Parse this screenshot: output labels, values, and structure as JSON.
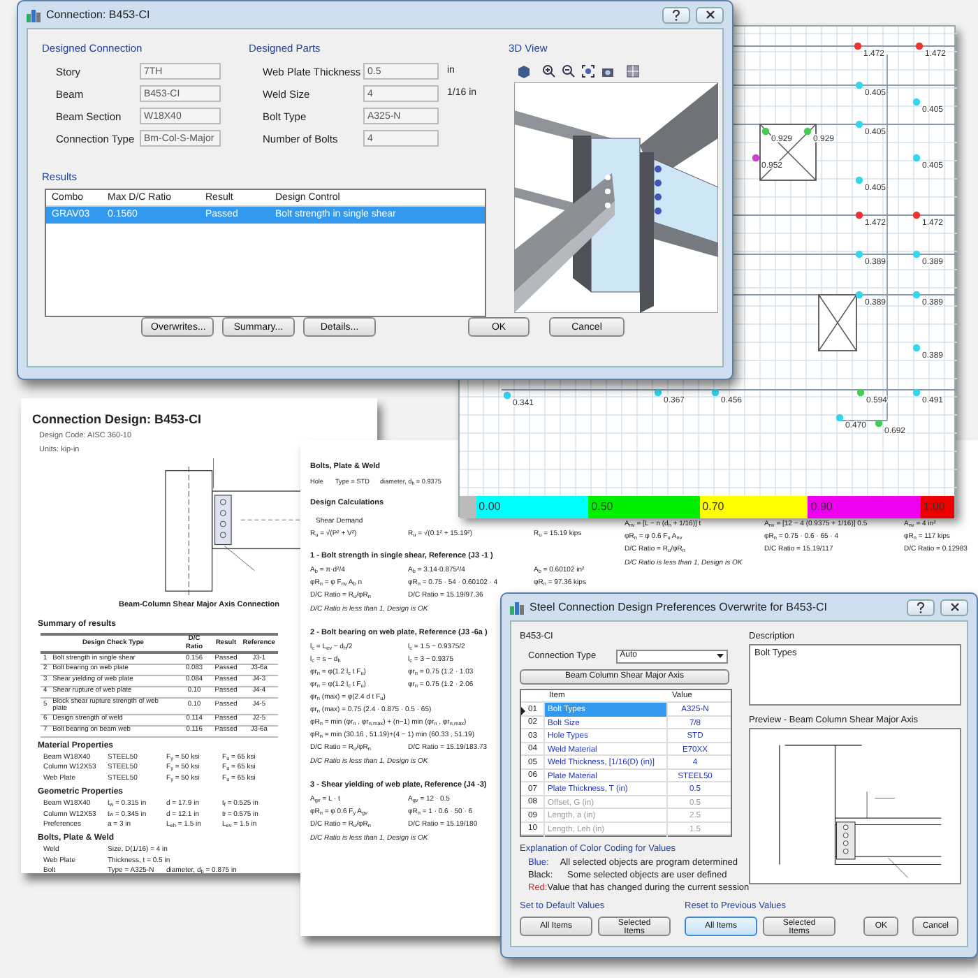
{
  "connection_dialog": {
    "title": "Connection: B453-CI",
    "designed_connection": {
      "heading": "Designed Connection",
      "fields": [
        {
          "label": "Story",
          "value": "7TH"
        },
        {
          "label": "Beam",
          "value": "B453-CI"
        },
        {
          "label": "Beam Section",
          "value": "W18X40"
        },
        {
          "label": "Connection Type",
          "value": "Bm-Col-S-Major"
        }
      ]
    },
    "designed_parts": {
      "heading": "Designed Parts",
      "fields": [
        {
          "label": "Web Plate Thickness",
          "value": "0.5",
          "unit": "in"
        },
        {
          "label": "Weld Size",
          "value": "4",
          "unit": "1/16 in"
        },
        {
          "label": "Bolt Type",
          "value": "A325-N"
        },
        {
          "label": "Number of Bolts",
          "value": "4"
        }
      ]
    },
    "view_3d": {
      "heading": "3D View"
    },
    "results": {
      "heading": "Results",
      "columns": [
        "Combo",
        "Max D/C Ratio",
        "Result",
        "Design Control"
      ],
      "rows": [
        {
          "cells": [
            "GRAV03",
            "0.1560",
            "Passed",
            "Bolt strength in single shear"
          ],
          "selected": true
        }
      ]
    },
    "buttons": [
      "Overwrites...",
      "Summary...",
      "Details..."
    ],
    "ok": "OK",
    "cancel": "Cancel"
  },
  "model_view": {
    "points": [
      {
        "label": "1.472",
        "color": "#ee3333"
      },
      {
        "label": "1.472",
        "color": "#ee3333"
      },
      {
        "label": "0.405",
        "color": "#33d6ee"
      },
      {
        "label": "0.405",
        "color": "#33d6ee"
      },
      {
        "label": "0.929",
        "color": "#44cc55"
      },
      {
        "label": "0.929",
        "color": "#44cc55"
      },
      {
        "label": "0.405",
        "color": "#33d6ee"
      },
      {
        "label": "0.952",
        "color": "#cc44cc"
      },
      {
        "label": "0.405",
        "color": "#33d6ee"
      },
      {
        "label": "0.405",
        "color": "#33d6ee"
      },
      {
        "label": "1.472",
        "color": "#ee3333"
      },
      {
        "label": "1.472",
        "color": "#ee3333"
      },
      {
        "label": "0.389",
        "color": "#33d6ee"
      },
      {
        "label": "0.389",
        "color": "#33d6ee"
      },
      {
        "label": "0.389",
        "color": "#33d6ee"
      },
      {
        "label": "0.389",
        "color": "#33d6ee"
      },
      {
        "label": "0.389",
        "color": "#33d6ee"
      },
      {
        "label": "0.341",
        "color": "#33d6ee"
      },
      {
        "label": "0.367",
        "color": "#33d6ee"
      },
      {
        "label": "0.456",
        "color": "#33d6ee"
      },
      {
        "label": "0.594",
        "color": "#44cc55"
      },
      {
        "label": "0.491",
        "color": "#33d6ee"
      },
      {
        "label": "0.470",
        "color": "#33d6ee"
      },
      {
        "label": "0.692",
        "color": "#44cc55"
      }
    ],
    "legend": [
      {
        "label": "0.00",
        "color": "#00ffff"
      },
      {
        "label": "0.50",
        "color": "#00ee00"
      },
      {
        "label": "0.70",
        "color": "#ffff00"
      },
      {
        "label": "0.90",
        "color": "#ee00ee"
      },
      {
        "label": "1.00",
        "color": "#ee0000"
      }
    ]
  },
  "summary_report": {
    "title": "Connection Design: B453-CI",
    "design_code": "Design Code: AISC 360-10",
    "units": "Units: kip-in",
    "caption": "Beam-Column Shear Major Axis Connection",
    "summary": {
      "heading": "Summary of results",
      "columns": [
        "",
        "Design Check Type",
        "D/C Ratio",
        "Result",
        "Reference"
      ],
      "rows": [
        [
          "1",
          "Bolt strength in single shear",
          "0.156",
          "Passed",
          "J3-1"
        ],
        [
          "2",
          "Bolt bearing on web plate",
          "0.083",
          "Passed",
          "J3-6a"
        ],
        [
          "3",
          "Shear yielding of web plate",
          "0.084",
          "Passed",
          "J4-3"
        ],
        [
          "4",
          "Shear rupture of web plate",
          "0.10",
          "Passed",
          "J4-4"
        ],
        [
          "5",
          "Block shear rupture strength of web plate",
          "0.10",
          "Passed",
          "J4-5"
        ],
        [
          "6",
          "Design strength of weld",
          "0.114",
          "Passed",
          "J2-5"
        ],
        [
          "7",
          "Bolt bearing on beam web",
          "0.116",
          "Passed",
          "J3-6a"
        ]
      ]
    },
    "sections": [
      {
        "heading": "Material Properties",
        "rows": [
          [
            "Beam W18X40",
            "STEEL50",
            "F$_{y}$ = 50 ksi",
            "F$_{u}$ = 65 ksi"
          ],
          [
            "Column W12X53",
            "STEEL50",
            "F$_{y}$ = 50 ksi",
            "F$_{u}$ = 65 ksi"
          ],
          [
            "Web Plate",
            "STEEL50",
            "F$_{y}$ = 50 ksi",
            "F$_{u}$ = 65 ksi"
          ]
        ]
      },
      {
        "heading": "Geometric Properties",
        "rows": [
          [
            "Beam W18X40",
            "t$_{w}$ = 0.315 in",
            "d = 17.9 in",
            "t$_{f}$ = 0.525 in"
          ],
          [
            "Column W12X53",
            "t$_{w}$ = 0.345 in",
            "d = 12.1 in",
            "t$_{f}$ = 0.575 in"
          ],
          [
            "Preferences",
            "a = 3 in",
            "L$_{eh}$ = 1.5 in",
            "L$_{ev}$ = 1.5 in"
          ]
        ]
      },
      {
        "heading": "Bolts, Plate & Weld",
        "rows": [
          [
            "Weld",
            "Size, D(1/16) = 4 in"
          ],
          [
            "Web Plate",
            "Thickness, t = 0.5 in"
          ],
          [
            "Bolt",
            "Type = A325-N",
            "diameter, d$_{b}$ = 0.875 in"
          ]
        ]
      }
    ]
  },
  "calculation_report": {
    "left": [
      {
        "kind": "heading",
        "cells": [
          "Bolts, Plate & Weld"
        ]
      },
      {
        "kind": "spec",
        "cells": [
          "Hole",
          "Type = STD",
          "diameter, d$_{h}$ = 0.9375"
        ]
      },
      {
        "kind": "heading",
        "cells": [
          "Design Calculations"
        ]
      },
      {
        "kind": "label",
        "cells": [
          "Shear Demand"
        ]
      },
      {
        "kind": "formula",
        "cells": [
          "R$_{u}$ = √(P² + V²)",
          "R$_{u}$ = √(0.1² + 15.19²)",
          "R$_{u}$ = 15.19 kips"
        ]
      },
      {
        "kind": "heading",
        "cells": [
          "1 - Bolt strength in single shear, Reference (J3 -1 )"
        ]
      },
      {
        "kind": "formula",
        "cells": [
          "A$_{b}$ = π·d²/4",
          "A$_{b}$ = 3.14·0.875²/4",
          "A$_{b}$ = 0.60102 in²"
        ]
      },
      {
        "kind": "formula",
        "cells": [
          "φR$_{n}$ = φ F$_{nv}$ A$_{b}$ n",
          "φR$_{n}$ = 0.75 · 54 · 0.60102 · 4",
          "φR$_{n}$ = 97.36 kips"
        ]
      },
      {
        "kind": "formula",
        "cells": [
          "D/C Ratio = R$_{u}$/φR$_{n}$",
          "D/C Ratio = 15.19/97.36"
        ]
      },
      {
        "kind": "note",
        "cells": [
          "D/C Ratio is less than 1, Design is OK"
        ]
      },
      {
        "kind": "heading",
        "cells": [
          "2 - Bolt bearing on web plate, Reference (J3 -6a )"
        ]
      },
      {
        "kind": "formula",
        "cells": [
          "l$_{c}$ = L$_{ev}$ − d$_{h}$/2",
          "l$_{c}$ = 1.5 − 0.9375/2"
        ]
      },
      {
        "kind": "formula",
        "cells": [
          "l$_{c}$ = s − d$_{h}$",
          "l$_{c}$ = 3 − 0.9375"
        ]
      },
      {
        "kind": "formula",
        "cells": [
          "φr$_{n}$ = φ(1.2 l$_{c}$ t F$_{u}$)",
          "φr$_{n}$ = 0.75 (1.2 · 1.03"
        ]
      },
      {
        "kind": "formula",
        "cells": [
          "φr$_{n}$ = φ(1.2 l$_{c}$ t F$_{u}$)",
          "φr$_{n}$ = 0.75 (1.2 · 2.06"
        ]
      },
      {
        "kind": "wide",
        "cells": [
          "φr$_{n}$ (max) = φ(2.4 d t F$_{u}$)"
        ]
      },
      {
        "kind": "wide",
        "cells": [
          "φr$_{n}$ (max) = 0.75 (2.4 · 0.875 · 0.5 · 65)"
        ]
      },
      {
        "kind": "wide",
        "cells": [
          "φR$_{n}$ = min (φr$_{n}$ , φr$_{n,max}$) + (n−1) min (φr$_{n}$ , φr$_{n,max}$)"
        ]
      },
      {
        "kind": "wide",
        "cells": [
          "φR$_{n}$ = min (30.16 , 51.19)+(4 − 1) min (60.33 , 51.19)"
        ]
      },
      {
        "kind": "formula",
        "cells": [
          "D/C Ratio = R$_{u}$/φR$_{n}$",
          "D/C Ratio = 15.19/183.73"
        ]
      },
      {
        "kind": "note",
        "cells": [
          "D/C Ratio is less than 1, Design is OK"
        ]
      },
      {
        "kind": "heading",
        "cells": [
          "3 - Shear yielding of web plate, Reference (J4 -3)"
        ]
      },
      {
        "kind": "formula",
        "cells": [
          "A$_{gv}$ = L · t",
          "A$_{gv}$ = 12 · 0.5"
        ]
      },
      {
        "kind": "formula",
        "cells": [
          "φR$_{n}$ = φ 0.6 F$_{y}$ A$_{gv}$",
          "φR$_{n}$ = 1 · 0.6 · 50 · 6"
        ]
      },
      {
        "kind": "formula",
        "cells": [
          "D/C Ratio = R$_{u}$/φR$_{n}$",
          "D/C Ratio = 15.19/180"
        ]
      },
      {
        "kind": "note",
        "cells": [
          "D/C Ratio is less than 1, Design is OK"
        ]
      }
    ],
    "right": [
      {
        "kind": "formula",
        "cells": [
          "A$_{nv}$ = [L − n (d$_{h}$ + 1/16)] t",
          "A$_{nv}$ = [12 − 4 (0.9375 + 1/16)] 0.5",
          "A$_{nv}$ = 4 in²"
        ]
      },
      {
        "kind": "formula",
        "cells": [
          "φR$_{n}$ = φ 0.6 F$_{u}$ A$_{nv}$",
          "φR$_{n}$ = 0.75 · 0.6 · 65 · 4",
          "φR$_{n}$ = 117 kips"
        ]
      },
      {
        "kind": "formula",
        "cells": [
          "D/C Ratio = R$_{u}$/φR$_{n}$",
          "D/C Ratio = 15.19/117",
          "D/C Ratio = 0.12983"
        ]
      },
      {
        "kind": "note",
        "cells": [
          "D/C Ratio is less than 1, Design is OK"
        ]
      }
    ]
  },
  "overwrite_dialog": {
    "title": "Steel Connection Design Preferences Overwrite for B453-CI",
    "beam": "B453-CI",
    "connection_type": {
      "label": "Connection Type",
      "value": "Auto"
    },
    "type_button": "Beam Column Shear Major Axis",
    "grid": {
      "columns": [
        "Item",
        "Value"
      ],
      "rows": [
        {
          "number": "01",
          "item": "Bolt Types",
          "value": "A325-N",
          "selected": true,
          "disabled": false
        },
        {
          "number": "02",
          "item": "Bolt Size",
          "value": "7/8",
          "selected": false,
          "disabled": false
        },
        {
          "number": "03",
          "item": "Hole Types",
          "value": "STD",
          "selected": false,
          "disabled": false
        },
        {
          "number": "04",
          "item": "Weld Material",
          "value": "E70XX",
          "selected": false,
          "disabled": false
        },
        {
          "number": "05",
          "item": "Weld Thickness, [1/16(D) (in)]",
          "value": "4",
          "selected": false,
          "disabled": false
        },
        {
          "number": "06",
          "item": "Plate Material",
          "value": "STEEL50",
          "selected": false,
          "disabled": false
        },
        {
          "number": "07",
          "item": "Plate Thickness, T (in)",
          "value": "0.5",
          "selected": false,
          "disabled": false
        },
        {
          "number": "08",
          "item": "Offset, G (in)",
          "value": "0.5",
          "selected": false,
          "disabled": true
        },
        {
          "number": "09",
          "item": "Length, a (in)",
          "value": "2.5",
          "selected": false,
          "disabled": true
        },
        {
          "number": "10",
          "item": "Length, Leh (in)",
          "value": "1.5",
          "selected": false,
          "disabled": true
        }
      ]
    },
    "description": {
      "label": "Description",
      "text": "Bolt Types"
    },
    "preview": {
      "label": "Preview - Beam Column Shear Major Axis"
    },
    "color_coding": {
      "heading": "Explanation of Color Coding for Values",
      "items": [
        {
          "label": "Blue:",
          "text": "All selected objects are program determined",
          "color": "#2233cc"
        },
        {
          "label": "Black:",
          "text": "Some selected objects are user defined",
          "color": "#222222"
        },
        {
          "label": "Red:",
          "text": "Value that has changed during the current session",
          "color": "#dd2222"
        }
      ]
    },
    "default_values": {
      "heading": "Set to Default Values",
      "buttons": [
        "All Items",
        "Selected Items"
      ]
    },
    "previous_values": {
      "heading": "Reset to Previous Values",
      "buttons": [
        "All Items",
        "Selected Items"
      ]
    },
    "ok": "OK",
    "cancel": "Cancel"
  }
}
